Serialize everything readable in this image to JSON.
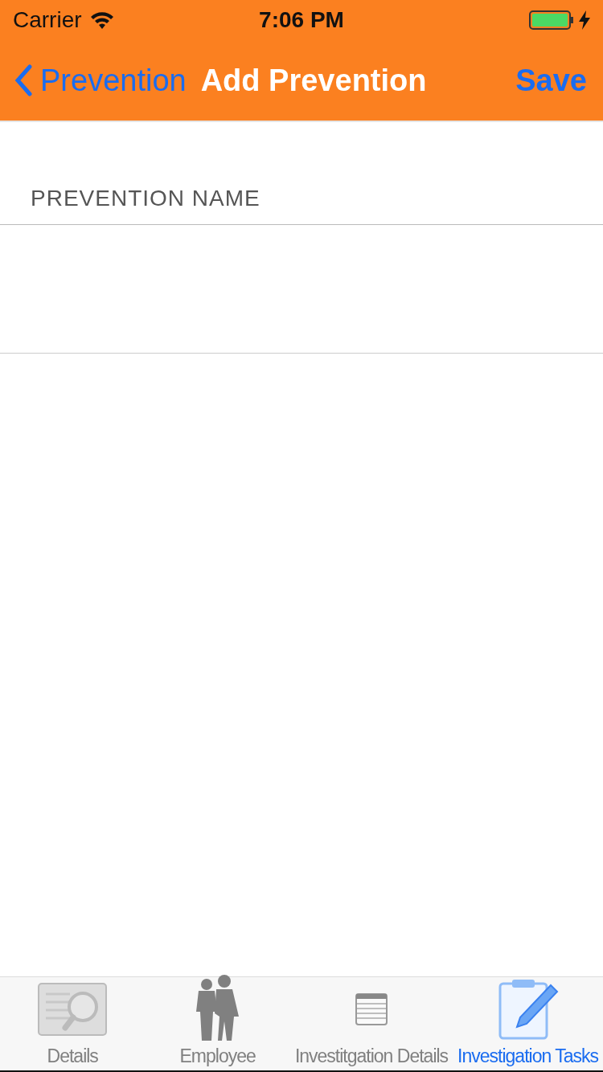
{
  "status_bar": {
    "carrier": "Carrier",
    "time": "7:06 PM"
  },
  "nav": {
    "back": "Prevention",
    "title": "Add Prevention",
    "action": "Save"
  },
  "section": {
    "header": "PREVENTION NAME"
  },
  "tabs": [
    {
      "label": "Details",
      "selected": false
    },
    {
      "label": "Employee",
      "selected": false
    },
    {
      "label": "Investitgation Details",
      "selected": false
    },
    {
      "label": "Investigation Tasks",
      "selected": true
    }
  ]
}
